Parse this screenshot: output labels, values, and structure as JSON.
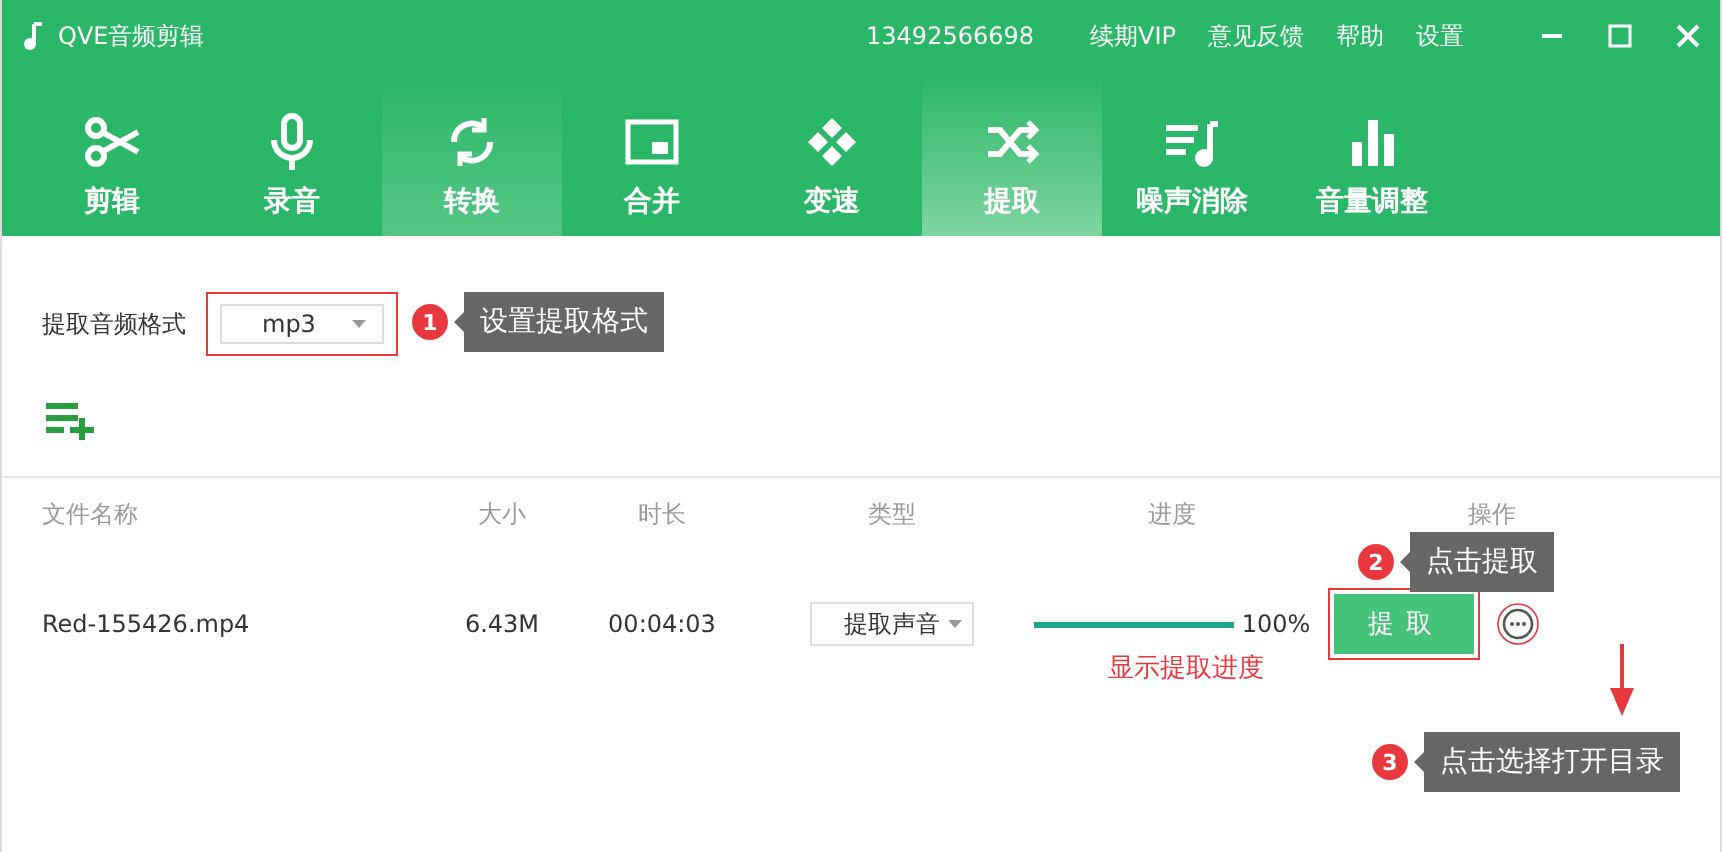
{
  "window": {
    "title": "QVE音频剪辑",
    "account": "13492566698",
    "menu": [
      "续期VIP",
      "意见反馈",
      "帮助",
      "设置"
    ]
  },
  "tabs": [
    {
      "label": "剪辑",
      "selected": false,
      "hovered": false
    },
    {
      "label": "录音",
      "selected": false,
      "hovered": false
    },
    {
      "label": "转换",
      "selected": false,
      "hovered": true
    },
    {
      "label": "合并",
      "selected": false,
      "hovered": false
    },
    {
      "label": "变速",
      "selected": false,
      "hovered": false
    },
    {
      "label": "提取",
      "selected": true,
      "hovered": false
    },
    {
      "label": "噪声消除",
      "selected": false,
      "hovered": false
    },
    {
      "label": "音量调整",
      "selected": false,
      "hovered": false
    }
  ],
  "format": {
    "label": "提取音频格式",
    "value": "mp3"
  },
  "table": {
    "columns": [
      "文件名称",
      "大小",
      "时长",
      "类型",
      "进度",
      "操作"
    ],
    "rows": [
      {
        "name": "Red-155426.mp4",
        "size": "6.43M",
        "duration": "00:04:03",
        "type": "提取声音",
        "level": 1,
        "percent": "100%",
        "action": "提取"
      }
    ]
  },
  "annotations": [
    {
      "number": "1",
      "text": "设置提取格式"
    },
    {
      "number": "2",
      "text": "点击提取"
    },
    {
      "number": "3",
      "text": "点击选择打开目录"
    }
  ],
  "progress_note": "显示提取进度"
}
